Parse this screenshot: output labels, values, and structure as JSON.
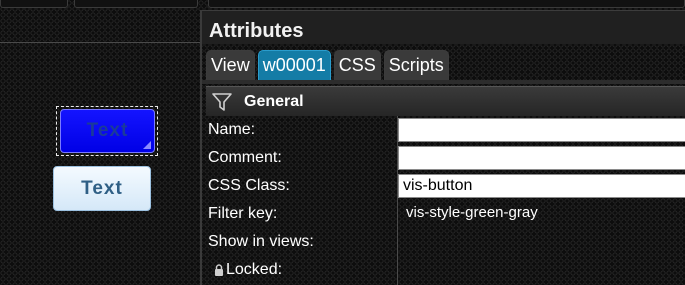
{
  "panel": {
    "title": "Attributes",
    "tabs": [
      {
        "label": "View",
        "active": false
      },
      {
        "label": "w00001",
        "active": true
      },
      {
        "label": "CSS",
        "active": false
      },
      {
        "label": "Scripts",
        "active": false
      }
    ],
    "section": {
      "title": "General",
      "icon": "filter-icon"
    },
    "fields": {
      "name": {
        "label": "Name:",
        "value": ""
      },
      "comment": {
        "label": "Comment:",
        "value": ""
      },
      "css_class": {
        "label": "CSS Class:",
        "value": "vis-button"
      },
      "filter_key": {
        "label": "Filter key:",
        "value": "vis-style-green-gray"
      },
      "show_in_views": {
        "label": "Show in views:"
      },
      "locked": {
        "label": "Locked:",
        "icon": "lock-icon"
      }
    }
  },
  "canvas": {
    "button_selected": {
      "label": "Text",
      "color": "#0a0aff"
    },
    "button_light": {
      "label": "Text",
      "color": "#e6f2fc"
    }
  },
  "colors": {
    "accent_tab": "#147ca6",
    "panel_header": "#202020",
    "background": "#0d0d0d"
  }
}
